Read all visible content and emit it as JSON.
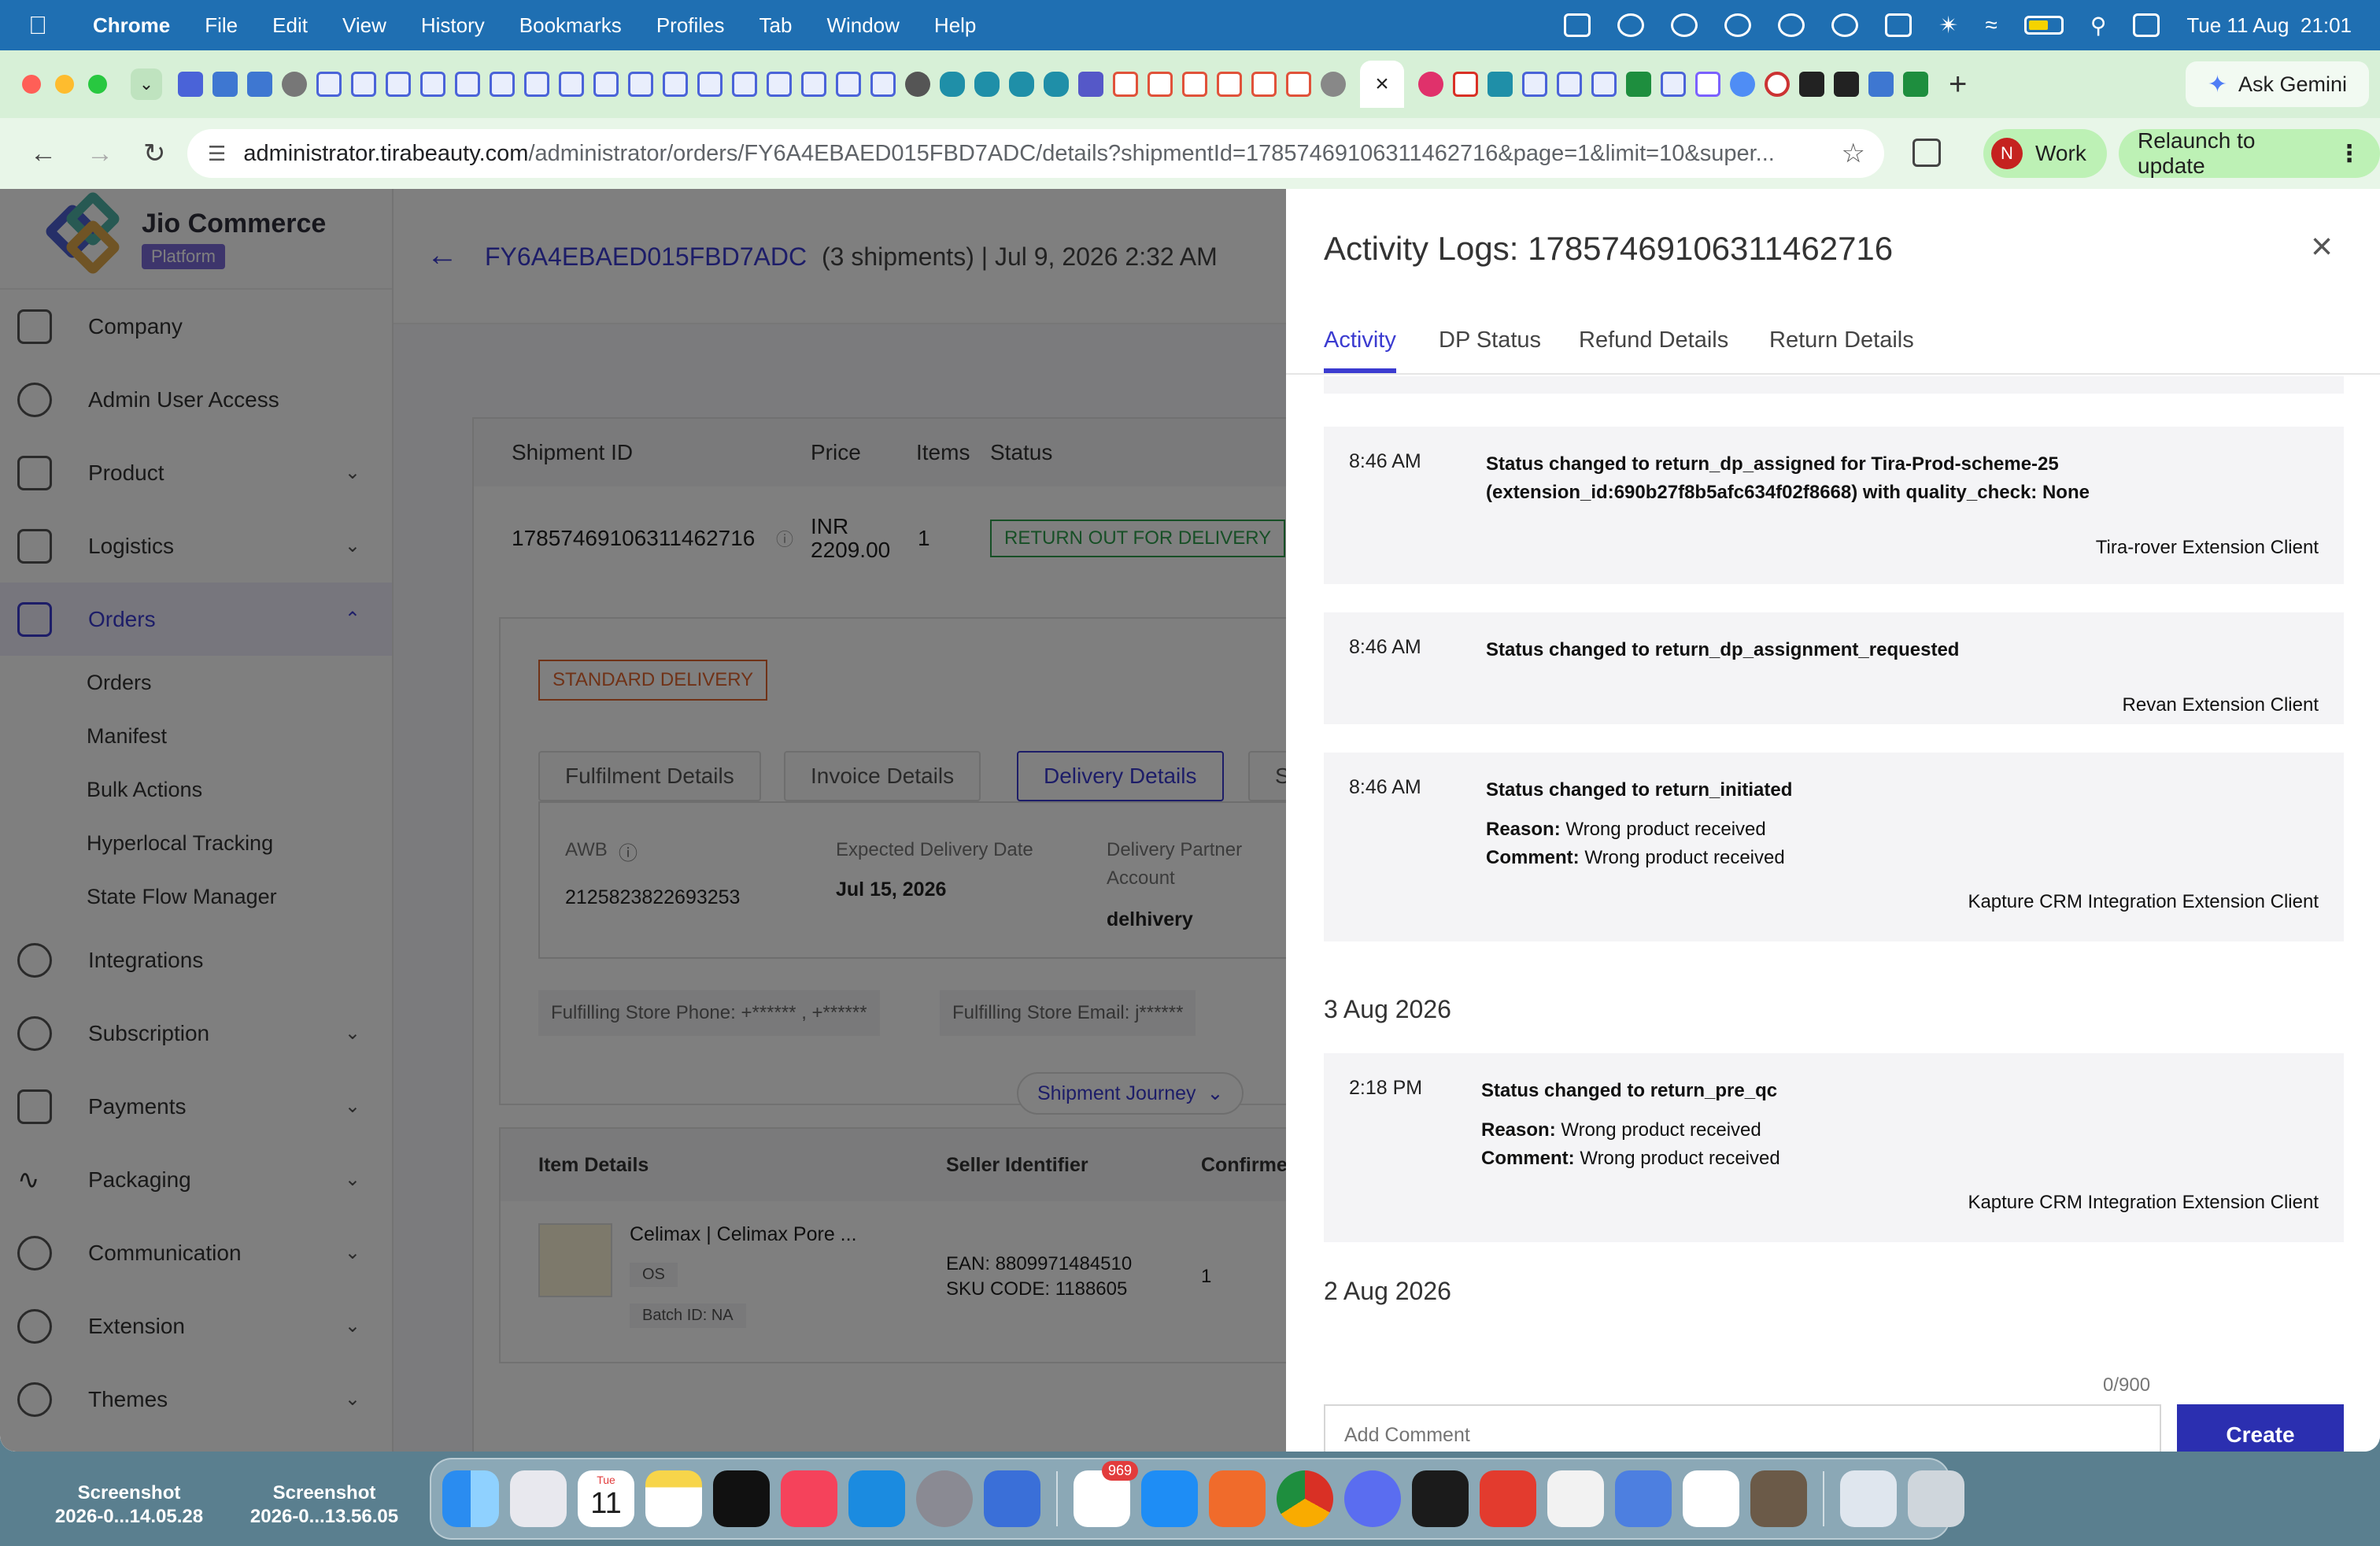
{
  "menubar": {
    "app_name": "Chrome",
    "items": [
      "File",
      "Edit",
      "View",
      "History",
      "Bookmarks",
      "Profiles",
      "Tab",
      "Window",
      "Help"
    ],
    "datetime": "Tue 11 Aug  21:01"
  },
  "browser": {
    "url_host": "administrator.tirabeauty.com",
    "url_path": "/administrator/orders/FY6A4EBAED015FBD7ADC/details?shipmentId=17857469106311462716&page=1&limit=10&super...",
    "ask_gemini": "Ask Gemini",
    "profile_initial": "N",
    "profile_name": "Work",
    "relaunch": "Relaunch to update"
  },
  "sidebar": {
    "brand_name": "Jio Commerce",
    "brand_badge": "Platform",
    "items": [
      {
        "label": "Company"
      },
      {
        "label": "Admin User Access"
      },
      {
        "label": "Product"
      },
      {
        "label": "Logistics"
      },
      {
        "label": "Orders"
      },
      {
        "label": "Integrations"
      },
      {
        "label": "Subscription"
      },
      {
        "label": "Payments"
      },
      {
        "label": "Packaging"
      },
      {
        "label": "Communication"
      },
      {
        "label": "Extension"
      },
      {
        "label": "Themes"
      }
    ],
    "orders_sub": [
      "Orders",
      "Manifest",
      "Bulk Actions",
      "Hyperlocal Tracking",
      "State Flow Manager"
    ]
  },
  "order": {
    "id": "FY6A4EBAED015FBD7ADC",
    "meta": "(3 shipments) | Jul 9, 2026 2:32 AM",
    "table_headers": [
      "Shipment ID",
      "Price",
      "Items",
      "Status"
    ],
    "shipment_id": "17857469106311462716",
    "currency": "INR",
    "price": "2209.00",
    "items": "1",
    "status": "RETURN OUT FOR DELIVERY",
    "delivery_type": "STANDARD DELIVERY",
    "detail_tabs": [
      "Fulfilment Details",
      "Invoice Details",
      "Delivery Details",
      "Shi"
    ],
    "awb_label": "AWB",
    "awb": "2125823822693253",
    "edd_label": "Expected Delivery Date",
    "edd": "Jul 15, 2026",
    "partner_label_1": "Delivery Partner",
    "partner_label_2": "Account",
    "partner": "delhivery",
    "store_phone": "Fulfilling Store Phone: +****** , +******",
    "store_email": "Fulfilling Store Email: j******",
    "journey": "Shipment Journey",
    "item_headers": [
      "Item Details",
      "Seller Identifier",
      "Confirmed"
    ],
    "item_name": "Celimax | Celimax Pore ...",
    "item_size": "OS",
    "item_batch": "Batch ID: NA",
    "ean": "EAN: 8809971484510",
    "sku": "SKU CODE: 1188605",
    "confirmed": "1"
  },
  "drawer": {
    "title": "Activity Logs: 17857469106311462716",
    "tabs": [
      "Activity",
      "DP Status",
      "Refund Details",
      "Return Details"
    ],
    "logs": [
      {
        "time": "8:46 AM",
        "message": "Status changed to return_dp_assigned for Tira-Prod-scheme-25 (extension_id:690b27f8b5afc634f02f8668) with quality_check: None",
        "source": "Tira-rover Extension Client"
      },
      {
        "time": "8:46 AM",
        "message": "Status changed to return_dp_assignment_requested",
        "source": "Revan Extension Client"
      },
      {
        "time": "8:46 AM",
        "message": "Status changed to return_initiated",
        "reason": "Wrong product received",
        "comment": "Wrong product received",
        "source": "Kapture CRM Integration Extension Client"
      },
      {
        "time": "2:18 PM",
        "message": "Status changed to return_pre_qc",
        "reason": "Wrong product received",
        "comment": "Wrong product received",
        "source": "Kapture CRM Integration Extension Client"
      }
    ],
    "reason_label": "Reason:",
    "comment_label": "Comment:",
    "date_1": "3 Aug 2026",
    "date_2": "2 Aug 2026",
    "counter": "0/900",
    "comment_placeholder": "Add Comment",
    "create": "Create"
  },
  "desktop": {
    "files": [
      {
        "line1": "Screenshot",
        "line2": "2026-0...14.05.28"
      },
      {
        "line1": "Screenshot",
        "line2": "2026-0...13.56.05"
      }
    ],
    "calendar_month": "Tue",
    "calendar_day": "11",
    "slack_badge": "969"
  }
}
